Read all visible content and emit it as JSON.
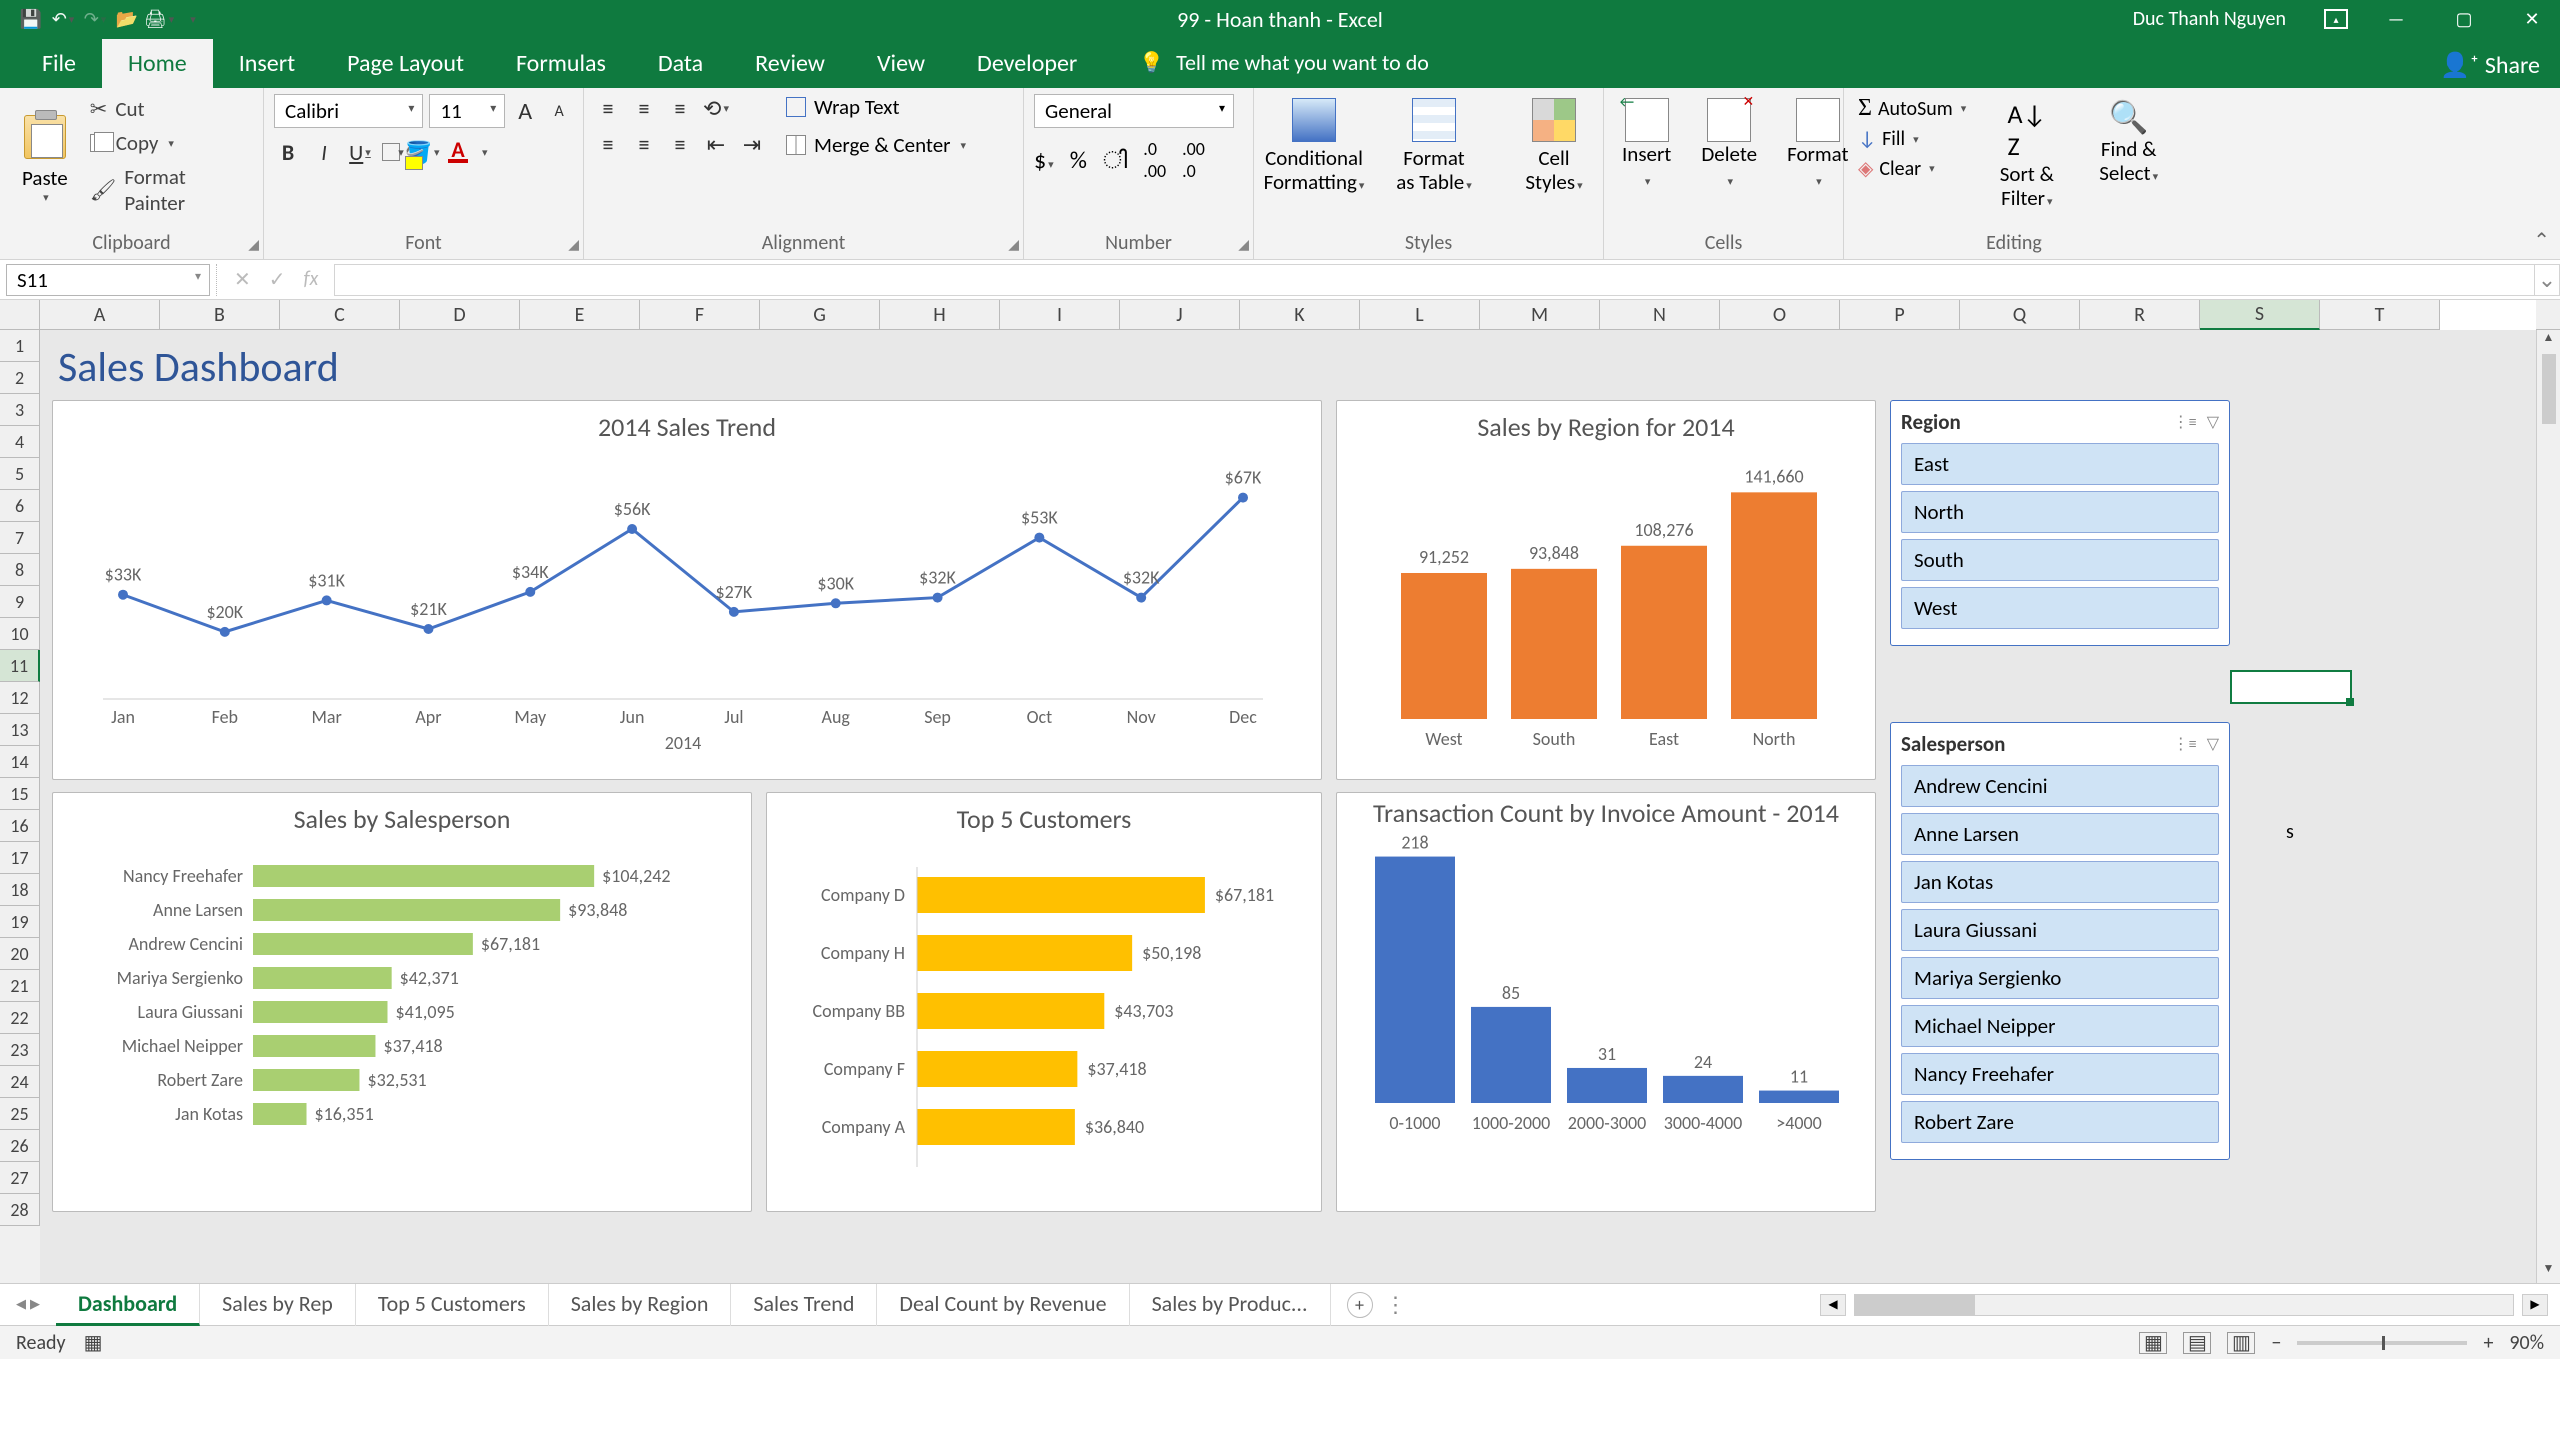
{
  "app": {
    "title": "99 - Hoan thanh - Excel",
    "user": "Duc Thanh Nguyen"
  },
  "ribbon": {
    "tabs": [
      "File",
      "Home",
      "Insert",
      "Page Layout",
      "Formulas",
      "Data",
      "Review",
      "View",
      "Developer"
    ],
    "active": "Home",
    "tellme": "Tell me what you want to do",
    "share": "Share",
    "clipboard": {
      "label": "Clipboard",
      "paste": "Paste",
      "cut": "Cut",
      "copy": "Copy",
      "painter": "Format Painter"
    },
    "font": {
      "label": "Font",
      "name": "Calibri",
      "size": "11"
    },
    "alignment": {
      "label": "Alignment",
      "wrap": "Wrap Text",
      "merge": "Merge & Center"
    },
    "number": {
      "label": "Number",
      "format": "General"
    },
    "styles": {
      "label": "Styles",
      "cond": "Conditional Formatting",
      "fmtTable": "Format as Table",
      "cell": "Cell Styles"
    },
    "cells": {
      "label": "Cells",
      "insert": "Insert",
      "delete": "Delete",
      "format": "Format"
    },
    "editing": {
      "label": "Editing",
      "autosum": "AutoSum",
      "fill": "Fill",
      "clear": "Clear",
      "sort": "Sort & Filter",
      "find": "Find & Select"
    }
  },
  "formula_bar": {
    "namebox": "S11",
    "formula": ""
  },
  "columns": [
    "A",
    "B",
    "C",
    "D",
    "E",
    "F",
    "G",
    "H",
    "I",
    "J",
    "K",
    "L",
    "M",
    "N",
    "O",
    "P",
    "Q",
    "R",
    "S",
    "T"
  ],
  "rows": 28,
  "selected": {
    "col": "S",
    "row": 11
  },
  "stray_text": "s",
  "dashboard": {
    "title": "Sales Dashboard"
  },
  "slicers": {
    "region": {
      "title": "Region",
      "items": [
        "East",
        "North",
        "South",
        "West"
      ]
    },
    "salesperson": {
      "title": "Salesperson",
      "items": [
        "Andrew Cencini",
        "Anne Larsen",
        "Jan Kotas",
        "Laura Giussani",
        "Mariya Sergienko",
        "Michael Neipper",
        "Nancy Freehafer",
        "Robert Zare"
      ]
    }
  },
  "chart_data": [
    {
      "id": "trend",
      "type": "line",
      "title": "2014 Sales Trend",
      "xlabel": "2014",
      "categories": [
        "Jan",
        "Feb",
        "Mar",
        "Apr",
        "May",
        "Jun",
        "Jul",
        "Aug",
        "Sep",
        "Oct",
        "Nov",
        "Dec"
      ],
      "values": [
        33,
        20,
        31,
        21,
        34,
        56,
        27,
        30,
        32,
        53,
        32,
        67
      ],
      "value_labels": [
        "$33K",
        "$20K",
        "$31K",
        "$21K",
        "$34K",
        "$56K",
        "$27K",
        "$30K",
        "$32K",
        "$53K",
        "$32K",
        "$67K"
      ]
    },
    {
      "id": "region",
      "type": "bar",
      "title": "Sales by Region for 2014",
      "categories": [
        "West",
        "South",
        "East",
        "North"
      ],
      "values": [
        91252,
        93848,
        108276,
        141660
      ],
      "value_labels": [
        "91,252",
        "93,848",
        "108,276",
        "141,660"
      ]
    },
    {
      "id": "salesperson",
      "type": "bar-horizontal",
      "title": "Sales by Salesperson",
      "categories": [
        "Nancy Freehafer",
        "Anne Larsen",
        "Andrew Cencini",
        "Mariya Sergienko",
        "Laura Giussani",
        "Michael Neipper",
        "Robert Zare",
        "Jan Kotas"
      ],
      "values": [
        104242,
        93848,
        67181,
        42371,
        41095,
        37418,
        32531,
        16351
      ],
      "value_labels": [
        "$104,242",
        "$93,848",
        "$67,181",
        "$42,371",
        "$41,095",
        "$37,418",
        "$32,531",
        "$16,351"
      ]
    },
    {
      "id": "customers",
      "type": "bar-horizontal",
      "title": "Top 5 Customers",
      "categories": [
        "Company D",
        "Company H",
        "Company BB",
        "Company F",
        "Company A"
      ],
      "values": [
        67181,
        50198,
        43703,
        37418,
        36840
      ],
      "value_labels": [
        "$67,181",
        "$50,198",
        "$43,703",
        "$37,418",
        "$36,840"
      ]
    },
    {
      "id": "transactions",
      "type": "bar",
      "title": "Transaction Count by Invoice Amount - 2014",
      "categories": [
        "0-1000",
        "1000-2000",
        "2000-3000",
        "3000-4000",
        ">4000"
      ],
      "values": [
        218,
        85,
        31,
        24,
        11
      ],
      "value_labels": [
        "218",
        "85",
        "31",
        "24",
        "11"
      ]
    }
  ],
  "sheet_tabs": {
    "active": "Dashboard",
    "tabs": [
      "Dashboard",
      "Sales by Rep",
      "Top 5 Customers",
      "Sales by Region",
      "Sales Trend",
      "Deal Count by Revenue",
      "Sales by Produc..."
    ]
  },
  "statusbar": {
    "ready": "Ready",
    "zoom": "90%"
  }
}
